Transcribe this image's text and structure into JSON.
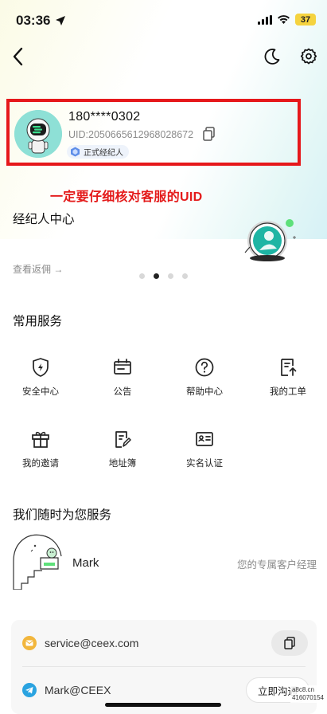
{
  "status_bar": {
    "time": "03:36",
    "battery": "37"
  },
  "profile": {
    "phone": "180****0302",
    "uid": "UID:2050665612968028672",
    "badge": "正式经纪人"
  },
  "annotation": "一定要仔细核对客服的UID",
  "agent_center": {
    "title": "经纪人中心",
    "link": "查看返佣 →",
    "carousel_dots": 4,
    "active_dot": 1
  },
  "common_services": {
    "title": "常用服务",
    "items": [
      {
        "label": "安全中心",
        "icon": "shield-icon"
      },
      {
        "label": "公告",
        "icon": "announcement-icon"
      },
      {
        "label": "帮助中心",
        "icon": "help-icon"
      },
      {
        "label": "我的工单",
        "icon": "ticket-icon"
      },
      {
        "label": "我的邀请",
        "icon": "gift-icon"
      },
      {
        "label": "地址簿",
        "icon": "address-book-icon"
      },
      {
        "label": "实名认证",
        "icon": "id-card-icon"
      }
    ]
  },
  "support": {
    "title": "我们随时为您服务",
    "agent_name": "Mark",
    "agent_role": "您的专属客户经理",
    "email": "service@ceex.com",
    "telegram": "Mark@CEEX",
    "chat_label": "立即沟通"
  },
  "watermark": {
    "line1": "a8c8.cn",
    "line2": "416070154"
  },
  "colors": {
    "accent_red": "#e6181b",
    "mint": "#8ee0d6",
    "battery": "#f5d33f"
  }
}
